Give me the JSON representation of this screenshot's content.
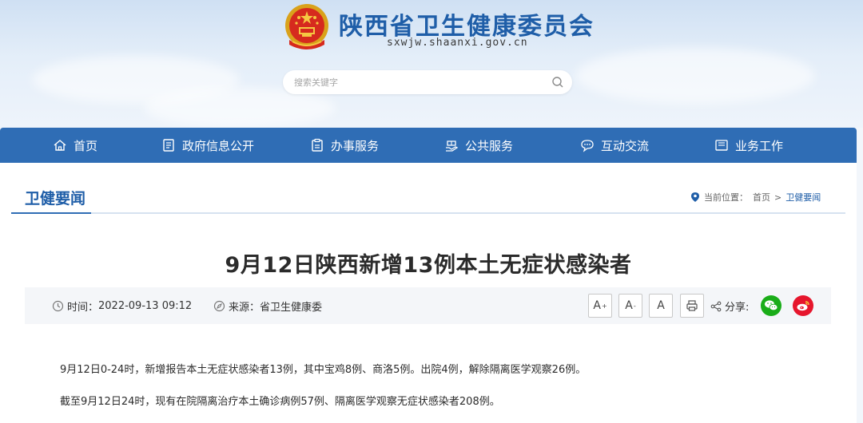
{
  "site": {
    "title": "陕西省卫生健康委员会",
    "domain": "sxwjw.shaanxi.gov.cn"
  },
  "search": {
    "placeholder": "搜索关键字"
  },
  "nav": {
    "items": [
      {
        "label": "首页",
        "icon": "home-icon"
      },
      {
        "label": "政府信息公开",
        "icon": "document-icon"
      },
      {
        "label": "办事服务",
        "icon": "clipboard-icon"
      },
      {
        "label": "公共服务",
        "icon": "service-hand-icon"
      },
      {
        "label": "互动交流",
        "icon": "chat-icon"
      },
      {
        "label": "业务工作",
        "icon": "briefcase-icon"
      }
    ]
  },
  "section": {
    "title": "卫健要闻"
  },
  "breadcrumb": {
    "prefix": "当前位置：",
    "home": "首页",
    "separator": ">",
    "current": "卫健要闻"
  },
  "article": {
    "title": "9月12日陕西新增13例本土无症状感染者",
    "time_label": "时间：",
    "time": "2022-09-13 09:12",
    "source_label": "来源：",
    "source": "省卫生健康委",
    "paragraphs": [
      "9月12日0-24时，新增报告本土无症状感染者13例，其中宝鸡8例、商洛5例。出院4例，解除隔离医学观察26例。",
      "截至9月12日24时，现有在院隔离治疗本土确诊病例57例、隔离医学观察无症状感染者208例。"
    ]
  },
  "tools": {
    "font_large": "A",
    "font_large_sup": "+",
    "font_small": "A",
    "font_small_sup": "-",
    "font_normal": "A",
    "share_label": "分享:"
  },
  "colors": {
    "brand_blue": "#2f6db5",
    "wechat_green": "#1aad19",
    "weibo_red": "#e6162d"
  }
}
